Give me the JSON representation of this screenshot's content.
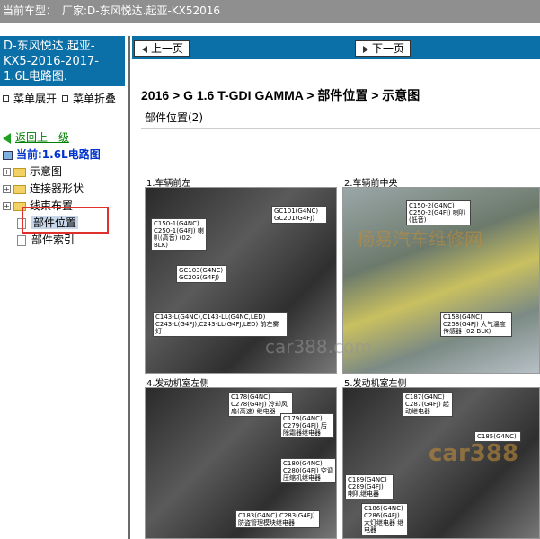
{
  "topbar": {
    "label": "当前车型：",
    "model": "厂家:D-东风悦达.起亚-KX52016"
  },
  "left": {
    "model_title": "D-东风悦达.起亚-KX5-2016-2017- 1.6L电路图.",
    "menu_expand": "菜单展开",
    "menu_collapse": "菜单折叠",
    "back": "返回上一级",
    "current": "当前:1.6L电路图",
    "items": [
      {
        "label": "示意图"
      },
      {
        "label": "连接器形状"
      },
      {
        "label": "线束布置"
      },
      {
        "label": "部件位置"
      },
      {
        "label": "部件索引"
      }
    ]
  },
  "nav": {
    "prev": "上一页",
    "next": "下一页"
  },
  "page": {
    "heading": "2016 > G 1.6 T-GDI GAMMA > 部件位置 > 示意图",
    "subhead": "部件位置(2)",
    "panels": [
      {
        "title": "1.车辆前左",
        "callouts": [
          "C150-1(G4NC) C250-1(G4FJ) 喇叭(高音) (02-BLK)",
          "GC101(G4NC) GC201(G4FJ)",
          "GC103(G4NC) GC203(G4FJ)",
          "C143-L(G4NC),C143-LL(G4NC,LED) C243-L(G4FJ),C243-LL(G4FJ,LED) 前左雾灯"
        ]
      },
      {
        "title": "2.车辆前中央",
        "callouts": [
          "C150-2(G4NC) C250-2(G4FJ) 喇叭(低音)",
          "C158(G4NC) C258(G4FJ) 大气温度传感器 (02-BLK)"
        ]
      },
      {
        "title": "4.发动机室左侧",
        "callouts": [
          "C178(G4NC) C278(G4FJ) 冷却风扇(高速) 继电器",
          "C179(G4NC) C279(G4FJ) 后除霜器继电器",
          "C180(G4NC) C280(G4FJ) 空调压缩机继电器",
          "C183(G4NC) C283(G4FJ) 防盗管理模块继电器"
        ]
      },
      {
        "title": "5.发动机室左侧",
        "callouts": [
          "C187(G4NC) C287(G4FJ) 起动继电器",
          "C185(G4NC)",
          "C189(G4NC) C289(G4FJ) 喇叭继电器",
          "C186(G4NC) C286(G4FJ) 大灯继电器 继电器"
        ]
      }
    ],
    "watermarks": [
      "杨易汽车维修网",
      "car388.com",
      "car388"
    ]
  }
}
